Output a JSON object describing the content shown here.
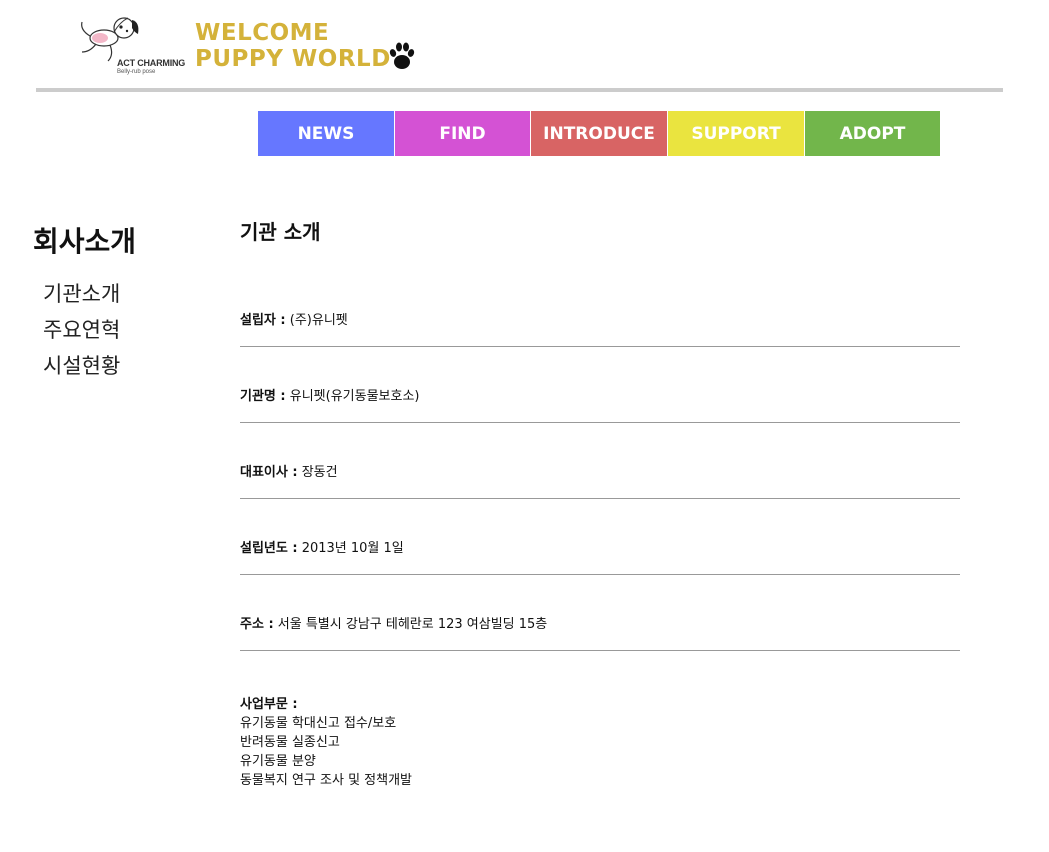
{
  "header": {
    "logo_line1": "ACT CHARMING",
    "logo_line2": "Belly-rub pose",
    "welcome_line1": "WELCOME",
    "welcome_line2": "PUPPY WORLD",
    "logo_icon": "puppy-logo-icon",
    "paw_icon": "paw-icon",
    "welcome_color": "#d4b23a"
  },
  "nav": [
    {
      "label": "NEWS",
      "color": "#6677ff"
    },
    {
      "label": "FIND",
      "color": "#d452d4"
    },
    {
      "label": "INTRODUCE",
      "color": "#d86464"
    },
    {
      "label": "SUPPORT",
      "color": "#eae43f"
    },
    {
      "label": "ADOPT",
      "color": "#72b64b"
    }
  ],
  "sidebar": {
    "title": "회사소개",
    "items": [
      "기관소개",
      "주요연혁",
      "시설현황"
    ]
  },
  "main": {
    "title": "기관 소개",
    "rows": [
      {
        "label": "설립자 :",
        "value": "(주)유니펫"
      },
      {
        "label": "기관명 :",
        "value": "유니펫(유기동물보호소)"
      },
      {
        "label": "대표이사 :",
        "value": "장동건"
      },
      {
        "label": "설립년도 :",
        "value": "2013년 10월 1일"
      },
      {
        "label": "주소 :",
        "value": "서울 특별시 강남구 테헤란로 123 여삼빌딩 15층"
      }
    ],
    "business": {
      "label": "사업부문 :",
      "items": [
        "유기동물 학대신고 접수/보호",
        "반려동물 실종신고",
        "유기동물 분양",
        "동물복지 연구 조사 및 정책개발"
      ]
    }
  }
}
